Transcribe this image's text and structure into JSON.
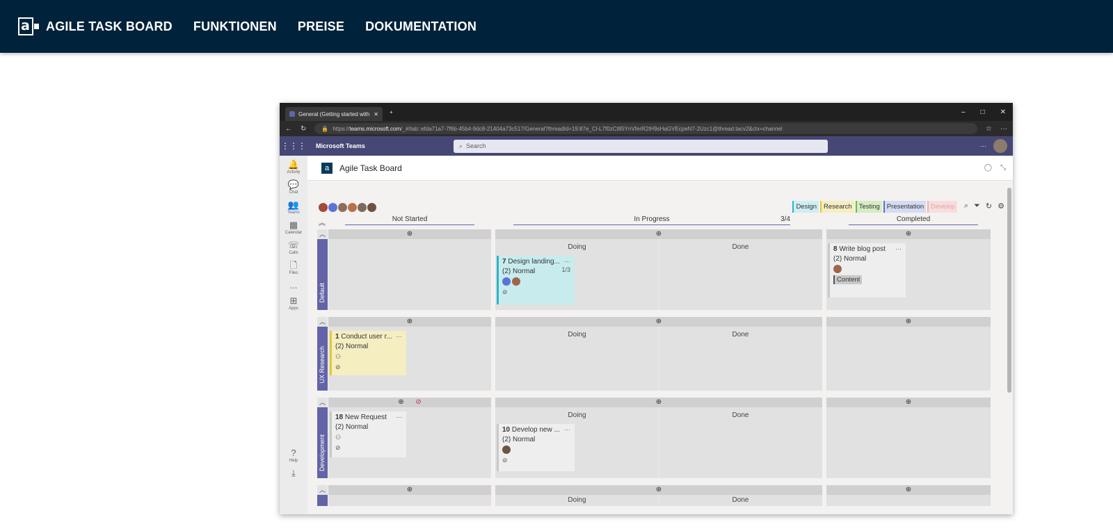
{
  "site_nav": {
    "brand_logo_letter": "a",
    "brand": "AGILE TASK BOARD",
    "links": [
      "FUNKTIONEN",
      "PREISE",
      "DOKUMENTATION"
    ]
  },
  "browser": {
    "tab_title": "General (Getting started with Ag",
    "url_prefix": "https://",
    "url_host": "teams.microsoft.com",
    "url_rest": "/_#/tab::efda71a7-7f6b-45b4-9dc8-21404a73c517/General?threadId=19:87e_Cl-L7f0zCt85YnVferR2tH9sHaGVEcpeN7-2Uzc1@thread.tacv2&ctx=channel"
  },
  "teams": {
    "app_name": "Microsoft Teams",
    "search_placeholder": "Search",
    "rail": [
      "Activity",
      "Chat",
      "Teams",
      "Calendar",
      "Calls",
      "Files",
      "...",
      "Apps",
      "Help"
    ]
  },
  "app": {
    "title": "Agile Task Board",
    "tags": [
      {
        "label": "Design",
        "bg": "#cdeef2",
        "border": "#2bb6c6",
        "color": "#333333"
      },
      {
        "label": "Research",
        "bg": "#f4eec1",
        "border": "#e0c93a",
        "color": "#333333"
      },
      {
        "label": "Testing",
        "bg": "#d5ecc4",
        "border": "#6dbb44",
        "color": "#333333"
      },
      {
        "label": "Presentation",
        "bg": "#d4dbf2",
        "border": "#5a6fc9",
        "color": "#333333"
      },
      {
        "label": "Develop",
        "bg": "#f7dede",
        "border": "#f0b2b2",
        "color": "#e5a2a2"
      }
    ],
    "columns": {
      "not_started": "Not Started",
      "in_progress": "In Progress",
      "in_progress_wip": "3/4",
      "completed": "Completed"
    },
    "sub_columns": {
      "doing": "Doing",
      "done": "Done"
    },
    "lanes": [
      "Default",
      "UX Research",
      "Development"
    ],
    "cards": {
      "c7": {
        "id": "7",
        "title": "Design landing...",
        "priority": "(2) Normal",
        "checklist": "1/3"
      },
      "c8": {
        "id": "8",
        "title": "Write blog post",
        "priority": "(2) Normal",
        "tag": "Content"
      },
      "c1": {
        "id": "1",
        "title": "Conduct user r...",
        "priority": "(2) Normal"
      },
      "c18": {
        "id": "18",
        "title": "New Request",
        "priority": "(2) Normal"
      },
      "c10": {
        "id": "10",
        "title": "Develop new ...",
        "priority": "(2) Normal"
      }
    }
  }
}
